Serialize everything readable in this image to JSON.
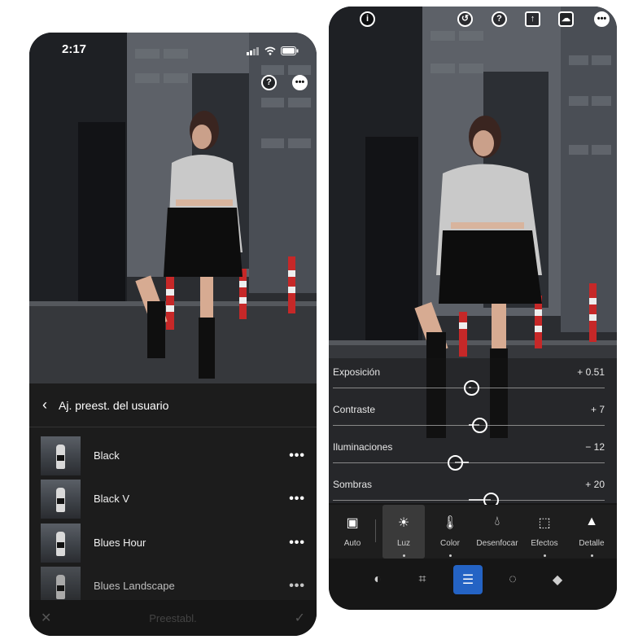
{
  "left_phone": {
    "status_time": "2:17",
    "header_title": "Aj. preest. del usuario",
    "presets": [
      {
        "label": "Black"
      },
      {
        "label": "Black V"
      },
      {
        "label": "Blues Hour"
      },
      {
        "label": "Blues Landscape"
      }
    ],
    "more_glyph": "•••",
    "footer_label": "Preestabl.",
    "icons": [
      "help-icon",
      "more-icon",
      "back-chevron-icon",
      "close-icon",
      "check-icon",
      "signal-icon",
      "wifi-icon",
      "battery-icon"
    ]
  },
  "right_phone": {
    "sliders": [
      {
        "label": "Exposición",
        "value": "+ 0.51",
        "position": 0.51
      },
      {
        "label": "Contraste",
        "value": "+ 7",
        "position": 0.54
      },
      {
        "label": "Iluminaciones",
        "value": "− 12",
        "position": 0.45
      },
      {
        "label": "Sombras",
        "value": "+ 20",
        "position": 0.58
      }
    ],
    "tools": [
      {
        "label": "Auto",
        "icon": "auto-icon"
      },
      {
        "label": "Luz",
        "icon": "sun-icon"
      },
      {
        "label": "Color",
        "icon": "thermometer-icon"
      },
      {
        "label": "Desenfocar",
        "icon": "drop-icon"
      },
      {
        "label": "Efectos",
        "icon": "effects-icon"
      },
      {
        "label": "Detalle",
        "icon": "triangle-icon"
      }
    ],
    "active_tool": "Luz",
    "bottom_tabs": [
      "selection-icon",
      "crop-icon",
      "adjust-icon",
      "healing-icon",
      "erase-icon"
    ],
    "active_tab": "adjust-icon",
    "top_icons": [
      "info-icon",
      "history-icon",
      "help-icon",
      "share-icon",
      "cloud-icon",
      "more-icon"
    ],
    "colors": {
      "accent": "#2463c4"
    }
  }
}
